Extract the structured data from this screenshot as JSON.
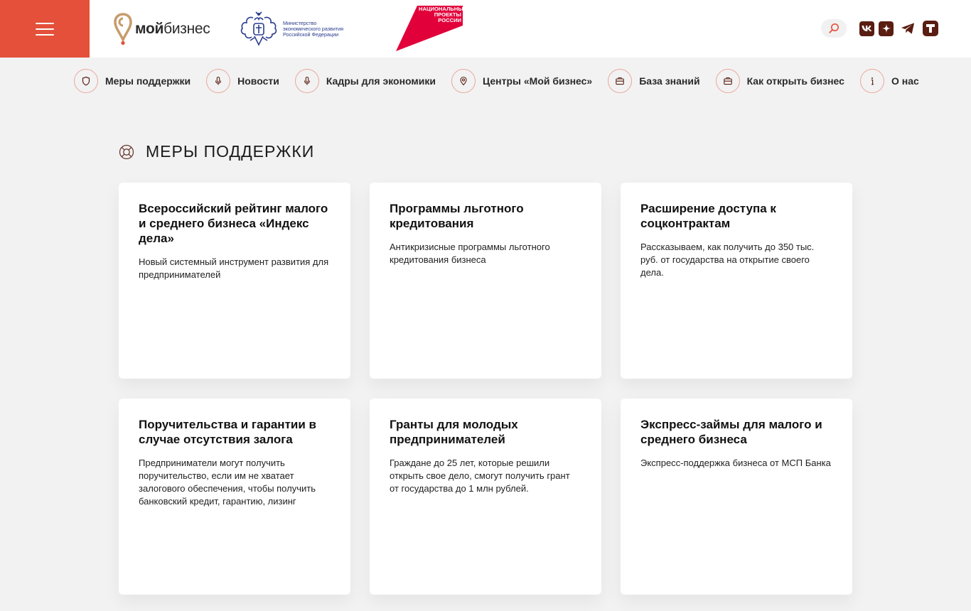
{
  "header": {
    "menu_label": "",
    "brand_word_bold": "мой",
    "brand_word_regular": "бизнес",
    "ministry_text": "Министерство экономического развития Российской Федерации",
    "np_text": "НАЦИОНАЛЬНЫЕ ПРОЕКТЫ РОССИИ",
    "colors": {
      "accent": "#e4503a",
      "social": "#5a1d12",
      "ministry": "#2a3d8f",
      "np": "#e2003b"
    }
  },
  "nav": {
    "items": [
      {
        "label": "Меры поддержки",
        "icon": "shield-icon"
      },
      {
        "label": "Новости",
        "icon": "microphone-icon"
      },
      {
        "label": "Кадры для экономики",
        "icon": "microphone-icon"
      },
      {
        "label": "Центры «Мой бизнес»",
        "icon": "location-pin-icon"
      },
      {
        "label": "База знаний",
        "icon": "briefcase-icon"
      },
      {
        "label": "Как открыть бизнес",
        "icon": "briefcase-icon"
      },
      {
        "label": "О нас",
        "icon": "info-icon"
      }
    ]
  },
  "section": {
    "title": "МЕРЫ ПОДДЕРЖКИ",
    "icon": "lifebuoy-icon"
  },
  "cards": [
    {
      "title": "Всероссийский рейтинг малого и среднего бизнеса «Индекс дела»",
      "desc": "Новый системный инструмент развития для предпринимателей"
    },
    {
      "title": "Программы льготного кредитования",
      "desc": "Антикризисные программы льготного кредитования бизнеса"
    },
    {
      "title": "Расширение доступа к соцконтрактам",
      "desc": "Рассказываем, как получить до 350 тыс. руб. от государства на открытие своего дела."
    },
    {
      "title": "Поручительства и гарантии в случае отсутствия залога",
      "desc": "Предприниматели могут получить поручительство, если им не хватает залогового обеспечения, чтобы получить банковский кредит, гарантию, лизинг"
    },
    {
      "title": "Гранты для молодых предпринимателей",
      "desc": "Граждане до 25 лет, которые решили открыть свое дело, смогут получить грант от государства до 1 млн рублей."
    },
    {
      "title": "Экспресс-займы для малого и среднего бизнеса",
      "desc": "Экспресс-поддержка бизнеса от МСП Банка"
    }
  ]
}
